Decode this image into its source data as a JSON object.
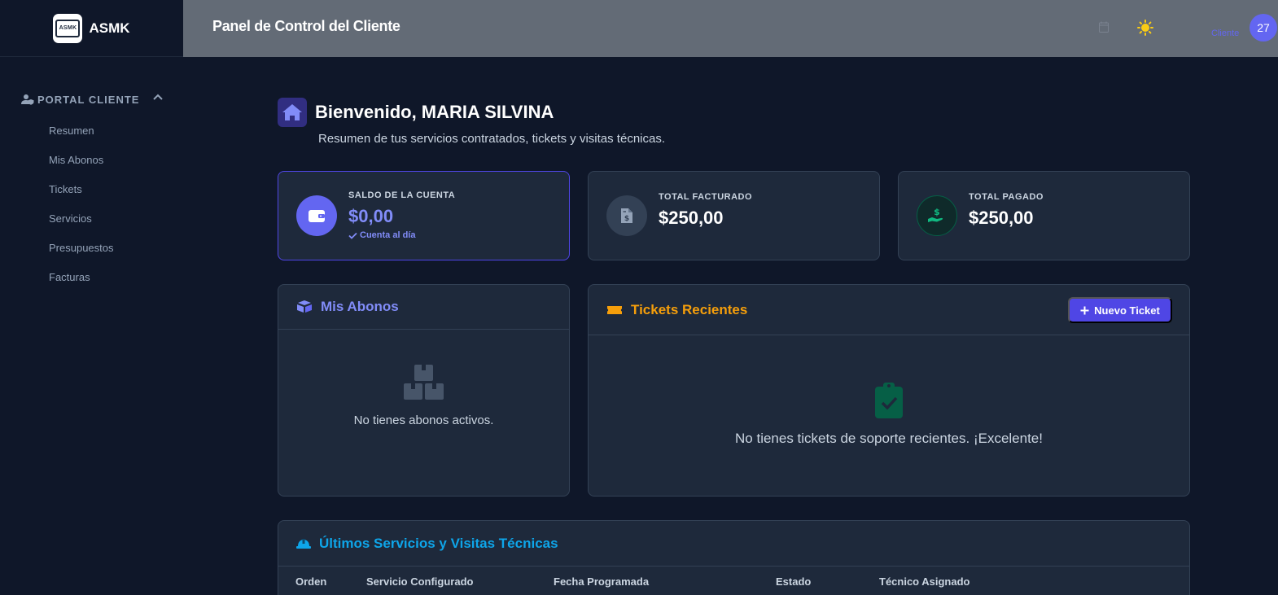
{
  "brand": {
    "name": "ASMK",
    "logo_text": "ASMK"
  },
  "sidebar": {
    "section_label": "PORTAL CLIENTE",
    "items": [
      {
        "label": "Resumen"
      },
      {
        "label": "Mis Abonos"
      },
      {
        "label": "Tickets"
      },
      {
        "label": "Servicios"
      },
      {
        "label": "Presupuestos"
      },
      {
        "label": "Facturas"
      }
    ]
  },
  "header": {
    "title": "Panel de Control del Cliente",
    "role": "Cliente",
    "avatar": "27",
    "icons": [
      "calendar-icon",
      "sun-icon"
    ]
  },
  "welcome": {
    "title": "Bienvenido, MARIA SILVINA",
    "subtitle": "Resumen de tus servicios contratados, tickets y visitas técnicas."
  },
  "stats": [
    {
      "label": "SALDO DE LA CUENTA",
      "value": "$0,00",
      "note": "Cuenta al día",
      "icon": "wallet-icon",
      "accent": "#6366f1"
    },
    {
      "label": "TOTAL FACTURADO",
      "value": "$250,00",
      "icon": "invoice-icon",
      "accent": "#334155"
    },
    {
      "label": "TOTAL PAGADO",
      "value": "$250,00",
      "icon": "hand-dollar-icon",
      "accent": "#10b981"
    }
  ],
  "abonos": {
    "title": "Mis Abonos",
    "empty": "No tienes abonos activos.",
    "color": "#818cf8"
  },
  "tickets": {
    "title": "Tickets Recientes",
    "new_button": "Nuevo Ticket",
    "empty": "No tienes tickets de soporte recientes. ¡Excelente!",
    "color": "#f59e0b"
  },
  "services": {
    "title": "Últimos Servicios y Visitas Técnicas",
    "color": "#0ea5e9",
    "columns": [
      "Orden",
      "Servicio Configurado",
      "Fecha Programada",
      "Estado",
      "Técnico Asignado"
    ]
  }
}
